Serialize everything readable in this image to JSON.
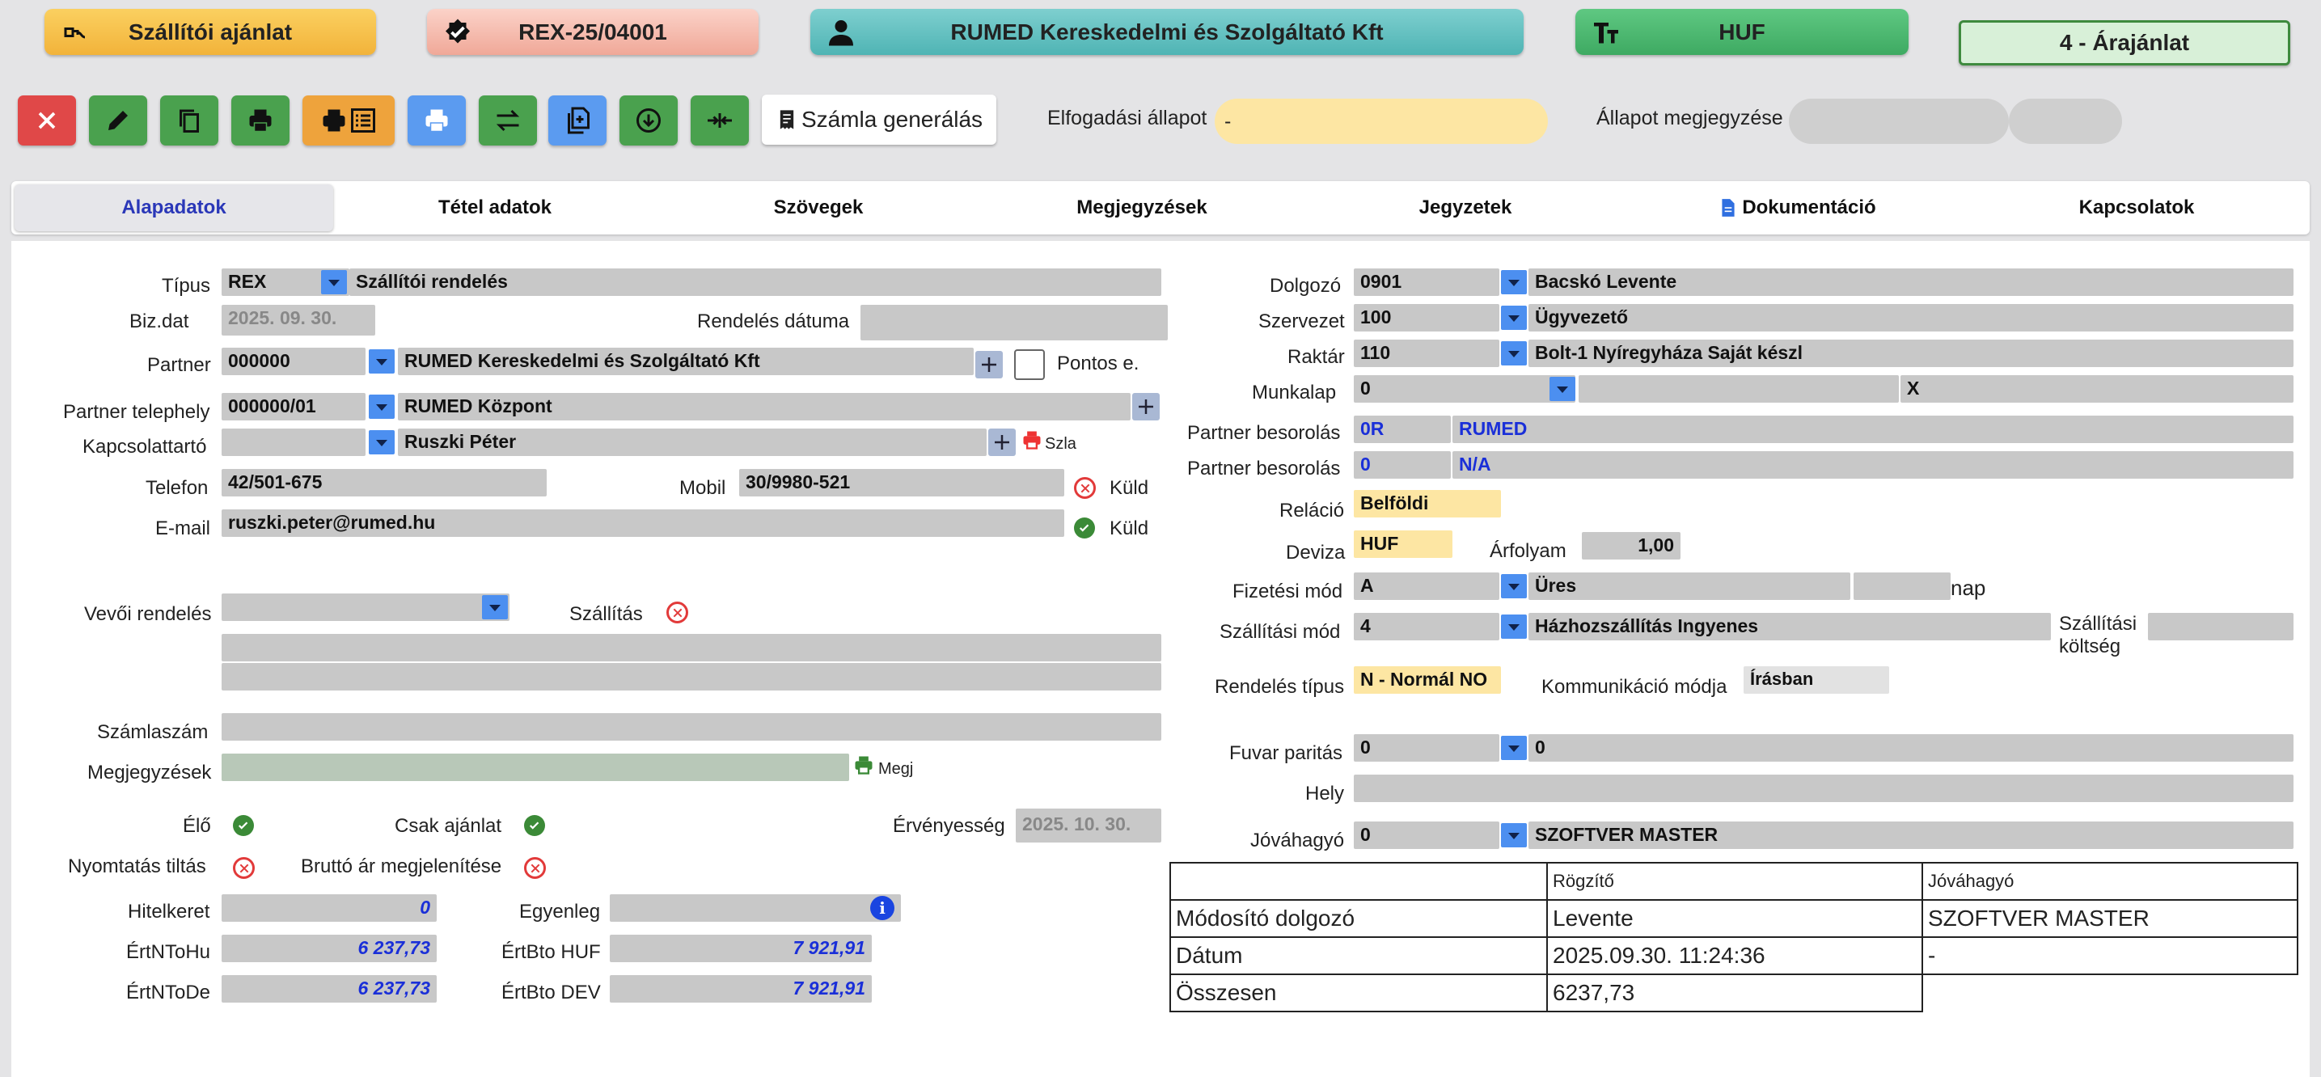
{
  "header": {
    "doc_type": "Szállítói ajánlat",
    "doc_number": "REX-25/04001",
    "partner": "RUMED Kereskedelmi és Szolgáltató Kft",
    "currency": "HUF",
    "status": "4 - Árajánlat"
  },
  "toolbar": {
    "generate_invoice": "Számla generálás",
    "acceptance_label": "Elfogadási állapot",
    "acceptance_value": "-",
    "status_note_label": "Állapot megjegyzése"
  },
  "tabs": [
    "Alapadatok",
    "Tétel adatok",
    "Szövegek",
    "Megjegyzések",
    "Jegyzetek",
    "Dokumentáció",
    "Kapcsolatok"
  ],
  "left": {
    "tipus_label": "Típus",
    "tipus_code": "REX",
    "tipus_name": "Szállítói rendelés",
    "bizdat_label": "Biz.dat",
    "bizdat": "2025. 09. 30.",
    "rendeles_datuma_label": "Rendelés dátuma",
    "partner_label": "Partner",
    "partner_code": "000000",
    "partner_name": "RUMED Kereskedelmi és Szolgáltató Kft",
    "pontos_label": "Pontos e.",
    "telephely_label": "Partner telephely",
    "telephely_code": "000000/01",
    "telephely_name": "RUMED Központ",
    "kapcsolattarto_label": "Kapcsolattartó",
    "kapcsolattarto_name": "Ruszki Péter",
    "szla_label": "Szla",
    "telefon_label": "Telefon",
    "telefon": "42/501-675",
    "mobil_label": "Mobil",
    "mobil": "30/9980-521",
    "kuld_label": "Küld",
    "email_label": "E-mail",
    "email": "ruszki.peter@rumed.hu",
    "vevoi_label": "Vevői rendelés",
    "szallitas_label": "Szállítás",
    "szamlaszam_label": "Számlaszám",
    "megjegyzesek_label": "Megjegyzések",
    "megj_label": "Megj",
    "elo_label": "Élő",
    "csak_ajanlat_label": "Csak ajánlat",
    "ervenyesseg_label": "Érvényesség",
    "ervenyesseg": "2025. 10. 30.",
    "nyomtatas_label": "Nyomtatás tiltás",
    "brutto_label": "Bruttó ár megjelenítése",
    "hitelkeret_label": "Hitelkeret",
    "hitelkeret": "0",
    "egyenleg_label": "Egyenleg",
    "ertntohu_label": "ÉrtNToHu",
    "ertntohu": "6 237,73",
    "ertbtohuf_label": "ÉrtBto HUF",
    "ertbtohuf": "7 921,91",
    "ertntode_label": "ÉrtNToDe",
    "ertntode": "6 237,73",
    "ertbtodev_label": "ÉrtBto DEV",
    "ertbtodev": "7 921,91"
  },
  "right": {
    "dolgozo_label": "Dolgozó",
    "dolgozo_code": "0901",
    "dolgozo_name": "Bacskó Levente",
    "szervezet_label": "Szervezet",
    "szervezet_code": "100",
    "szervezet_name": "Ügyvezető",
    "raktar_label": "Raktár",
    "raktar_code": "110",
    "raktar_name": "Bolt-1 Nyíregyháza Saját készl",
    "munkalap_label": "Munkalap",
    "munkalap_code": "0",
    "munkalap_x": "X",
    "besorolas1_label": "Partner besorolás",
    "besorolas1_code": "0R",
    "besorolas1_name": "RUMED",
    "besorolas2_label": "Partner besorolás",
    "besorolas2_code": "0",
    "besorolas2_name": "N/A",
    "relacio_label": "Reláció",
    "relacio": "Belföldi",
    "deviza_label": "Deviza",
    "deviza": "HUF",
    "arfolyam_label": "Árfolyam",
    "arfolyam": "1,00",
    "fizetesi_label": "Fizetési mód",
    "fizetesi_code": "A",
    "fizetesi_name": "Üres",
    "nap_label": "nap",
    "szallitasi_label": "Szállítási mód",
    "szallitasi_code": "4",
    "szallitasi_name": "Házhozszállítás Ingyenes",
    "szallitasi_koltseg_label1": "Szállítási",
    "szallitasi_koltseg_label2": "költség",
    "rendeles_tipus_label": "Rendelés típus",
    "rendeles_tipus": "N - Normál NO",
    "kommunikacio_label": "Kommunikáció módja",
    "kommunikacio": "Írásban",
    "fuvar_label": "Fuvar paritás",
    "fuvar_code": "0",
    "fuvar_name": "0",
    "hely_label": "Hely",
    "jovahagyo_label": "Jóváhagyó",
    "jovahagyo_code": "0",
    "jovahagyo_name": "SZOFTVER MASTER"
  },
  "info_table": {
    "headers": [
      "",
      "Rögzítő",
      "Jóváhagyó"
    ],
    "rows": [
      [
        "Módosító dolgozó",
        "Levente",
        "SZOFTVER MASTER"
      ],
      [
        "Dátum",
        "2025.09.30. 11:24:36",
        "-"
      ],
      [
        "Összesen",
        "6237,73",
        ""
      ]
    ]
  },
  "colors": {
    "accent_blue": "#4c8ff0",
    "green": "#4aa14e",
    "orange": "#eea33c",
    "red": "#e04848"
  }
}
